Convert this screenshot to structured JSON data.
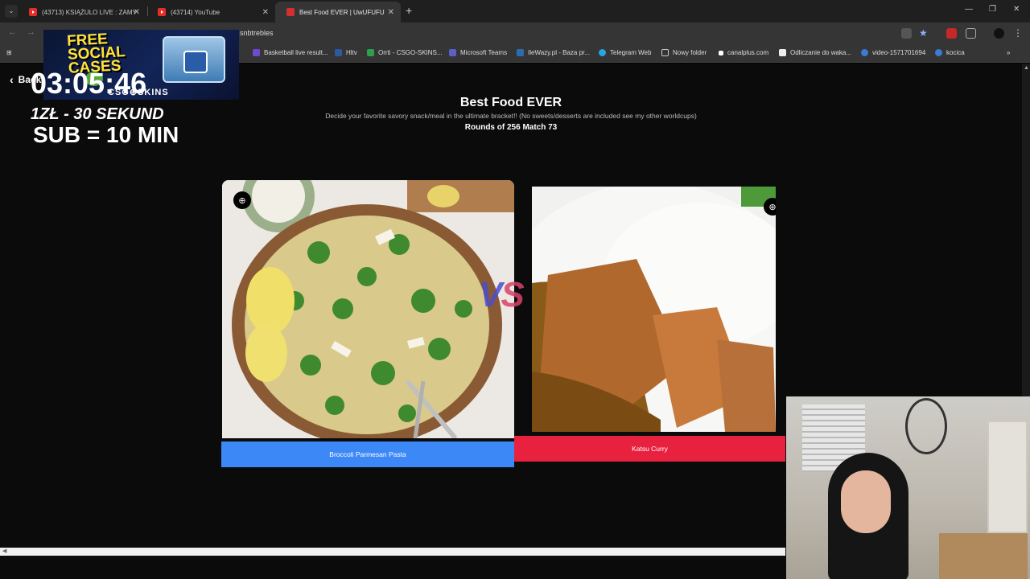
{
  "browser": {
    "tabs": [
      {
        "title": "(43713) KSIĄŻULO LIVE : ZAMY"
      },
      {
        "title": "(43714) YouTube"
      },
      {
        "title": "Best Food EVER | UwUFUFU"
      }
    ],
    "url": "snbtrebles",
    "bookmarks": [
      "Basketball live result...",
      "Hltv",
      "Orrti - CSGO-SKINS...",
      "Microsoft Teams",
      "IleWazy.pl - Baza pr...",
      "Telegram Web",
      "Nowy folder",
      "canalplus.com",
      "Odliczanie do waka...",
      "video-1571701694",
      "kocica"
    ]
  },
  "overlay": {
    "ad": {
      "headline_1": "FREE",
      "headline_2": "SOCIAL",
      "headline_3": "CASES",
      "logo": "CSG⊕SKINS"
    },
    "timer": "03:05:46",
    "rate": "1ZŁ - 30 SEKUND",
    "sub": "SUB = 10 MIN"
  },
  "page": {
    "back_label": "Back",
    "title": "Best Food EVER",
    "description": "Decide your favorite savory snack/meal in the ultimate bracket!! (No sweets/desserts are included see my other worldcups)",
    "round_info": "Rounds of 256 Match 73",
    "vs_v": "V",
    "vs_s": "S",
    "left_choice": "Broccoli Parmesan Pasta",
    "right_choice": "Katsu Curry"
  },
  "colors": {
    "left_button": "#3c88f7",
    "right_button": "#e8213f",
    "vs_v": "#4a4ecf",
    "vs_s": "#d8436a"
  }
}
